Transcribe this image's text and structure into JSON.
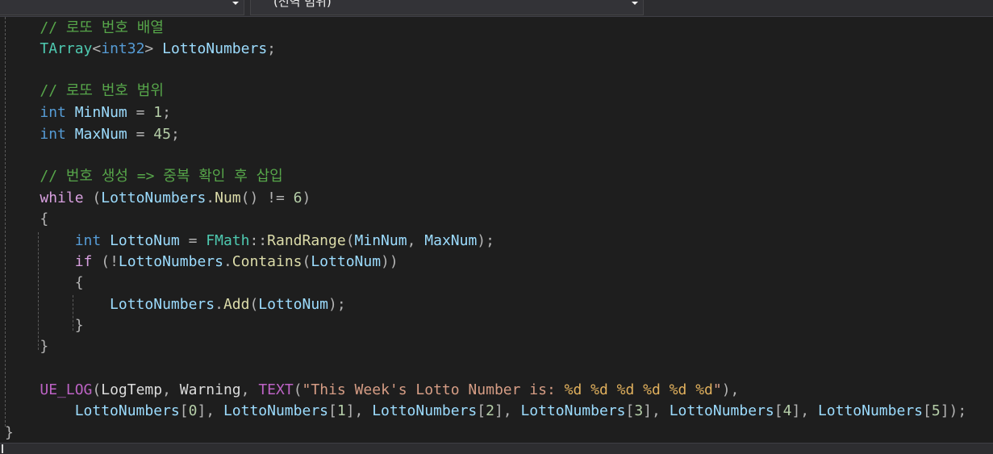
{
  "navigation_bar": {
    "left_dropdown": {
      "value": ""
    },
    "right_dropdown": {
      "value": "(전역 범위)"
    }
  },
  "editor": {
    "language": "C++",
    "lines": [
      {
        "tokens": [
          {
            "t": "    "
          },
          {
            "t": "// 로또 번호 배열",
            "k": "comment"
          }
        ]
      },
      {
        "tokens": [
          {
            "t": "    "
          },
          {
            "t": "TArray",
            "k": "type"
          },
          {
            "t": "<",
            "k": "punct"
          },
          {
            "t": "int32",
            "k": "kw"
          },
          {
            "t": ">",
            "k": "punct"
          },
          {
            "t": " "
          },
          {
            "t": "LottoNumbers",
            "k": "var"
          },
          {
            "t": ";",
            "k": "punct"
          }
        ]
      },
      {
        "tokens": []
      },
      {
        "tokens": [
          {
            "t": "    "
          },
          {
            "t": "// 로또 번호 범위",
            "k": "comment"
          }
        ]
      },
      {
        "tokens": [
          {
            "t": "    "
          },
          {
            "t": "int",
            "k": "kw"
          },
          {
            "t": " "
          },
          {
            "t": "MinNum",
            "k": "var"
          },
          {
            "t": " = ",
            "k": "punct"
          },
          {
            "t": "1",
            "k": "num"
          },
          {
            "t": ";",
            "k": "punct"
          }
        ]
      },
      {
        "tokens": [
          {
            "t": "    "
          },
          {
            "t": "int",
            "k": "kw"
          },
          {
            "t": " "
          },
          {
            "t": "MaxNum",
            "k": "var"
          },
          {
            "t": " = ",
            "k": "punct"
          },
          {
            "t": "45",
            "k": "num"
          },
          {
            "t": ";",
            "k": "punct"
          }
        ]
      },
      {
        "tokens": []
      },
      {
        "tokens": [
          {
            "t": "    "
          },
          {
            "t": "// 번호 생성 => 중복 확인 후 삽입",
            "k": "comment"
          }
        ]
      },
      {
        "tokens": [
          {
            "t": "    "
          },
          {
            "t": "while",
            "k": "ctrl"
          },
          {
            "t": " (",
            "k": "punct"
          },
          {
            "t": "LottoNumbers",
            "k": "var"
          },
          {
            "t": ".",
            "k": "punct"
          },
          {
            "t": "Num",
            "k": "func"
          },
          {
            "t": "() != ",
            "k": "punct"
          },
          {
            "t": "6",
            "k": "num"
          },
          {
            "t": ")",
            "k": "punct"
          }
        ]
      },
      {
        "tokens": [
          {
            "t": "    "
          },
          {
            "t": "{",
            "k": "punct"
          }
        ]
      },
      {
        "tokens": [
          {
            "t": "        "
          },
          {
            "t": "int",
            "k": "kw"
          },
          {
            "t": " "
          },
          {
            "t": "LottoNum",
            "k": "var"
          },
          {
            "t": " = ",
            "k": "punct"
          },
          {
            "t": "FMath",
            "k": "type"
          },
          {
            "t": "::",
            "k": "punct"
          },
          {
            "t": "RandRange",
            "k": "func"
          },
          {
            "t": "(",
            "k": "punct"
          },
          {
            "t": "MinNum",
            "k": "var"
          },
          {
            "t": ", ",
            "k": "punct"
          },
          {
            "t": "MaxNum",
            "k": "var"
          },
          {
            "t": ");",
            "k": "punct"
          }
        ]
      },
      {
        "tokens": [
          {
            "t": "        "
          },
          {
            "t": "if",
            "k": "ctrl"
          },
          {
            "t": " (!",
            "k": "punct"
          },
          {
            "t": "LottoNumbers",
            "k": "var"
          },
          {
            "t": ".",
            "k": "punct"
          },
          {
            "t": "Contains",
            "k": "func"
          },
          {
            "t": "(",
            "k": "punct"
          },
          {
            "t": "LottoNum",
            "k": "var"
          },
          {
            "t": "))",
            "k": "punct"
          }
        ]
      },
      {
        "tokens": [
          {
            "t": "        "
          },
          {
            "t": "{",
            "k": "punct"
          }
        ]
      },
      {
        "tokens": [
          {
            "t": "            "
          },
          {
            "t": "LottoNumbers",
            "k": "var"
          },
          {
            "t": ".",
            "k": "punct"
          },
          {
            "t": "Add",
            "k": "func"
          },
          {
            "t": "(",
            "k": "punct"
          },
          {
            "t": "LottoNum",
            "k": "var"
          },
          {
            "t": ");",
            "k": "punct"
          }
        ]
      },
      {
        "tokens": [
          {
            "t": "        "
          },
          {
            "t": "}",
            "k": "punct"
          }
        ]
      },
      {
        "tokens": [
          {
            "t": "    "
          },
          {
            "t": "}",
            "k": "punct"
          }
        ]
      },
      {
        "tokens": []
      },
      {
        "tokens": [
          {
            "t": "    "
          },
          {
            "t": "UE_LOG",
            "k": "macro"
          },
          {
            "t": "(",
            "k": "punct"
          },
          {
            "t": "LogTemp",
            "k": "plain"
          },
          {
            "t": ", ",
            "k": "punct"
          },
          {
            "t": "Warning",
            "k": "plain"
          },
          {
            "t": ", ",
            "k": "punct"
          },
          {
            "t": "TEXT",
            "k": "macro"
          },
          {
            "t": "(",
            "k": "punct"
          },
          {
            "t": "\"This Week's Lotto Number is: ",
            "k": "str"
          },
          {
            "t": "%d %d %d %d %d %d",
            "k": "fmt"
          },
          {
            "t": "\"",
            "k": "str"
          },
          {
            "t": "),",
            "k": "punct"
          }
        ]
      },
      {
        "tokens": [
          {
            "t": "        "
          },
          {
            "t": "LottoNumbers",
            "k": "var"
          },
          {
            "t": "[",
            "k": "punct"
          },
          {
            "t": "0",
            "k": "num"
          },
          {
            "t": "], ",
            "k": "punct"
          },
          {
            "t": "LottoNumbers",
            "k": "var"
          },
          {
            "t": "[",
            "k": "punct"
          },
          {
            "t": "1",
            "k": "num"
          },
          {
            "t": "], ",
            "k": "punct"
          },
          {
            "t": "LottoNumbers",
            "k": "var"
          },
          {
            "t": "[",
            "k": "punct"
          },
          {
            "t": "2",
            "k": "num"
          },
          {
            "t": "], ",
            "k": "punct"
          },
          {
            "t": "LottoNumbers",
            "k": "var"
          },
          {
            "t": "[",
            "k": "punct"
          },
          {
            "t": "3",
            "k": "num"
          },
          {
            "t": "], ",
            "k": "punct"
          },
          {
            "t": "LottoNumbers",
            "k": "var"
          },
          {
            "t": "[",
            "k": "punct"
          },
          {
            "t": "4",
            "k": "num"
          },
          {
            "t": "], ",
            "k": "punct"
          },
          {
            "t": "LottoNumbers",
            "k": "var"
          },
          {
            "t": "[",
            "k": "punct"
          },
          {
            "t": "5",
            "k": "num"
          },
          {
            "t": "]);",
            "k": "punct"
          }
        ]
      },
      {
        "tokens": [
          {
            "t": "}",
            "k": "punct"
          }
        ]
      }
    ]
  },
  "colors": {
    "editor_background": "#1e1e1e",
    "comment": "#57a64a",
    "keyword": "#569cd6",
    "control_keyword": "#d8a0df",
    "type": "#4ec9b0",
    "variable": "#9cdcfe",
    "function": "#dcdcaa",
    "macro": "#bd63c5",
    "number": "#b5cea8",
    "string": "#d69d85",
    "format_specifier": "#e0b05d"
  }
}
